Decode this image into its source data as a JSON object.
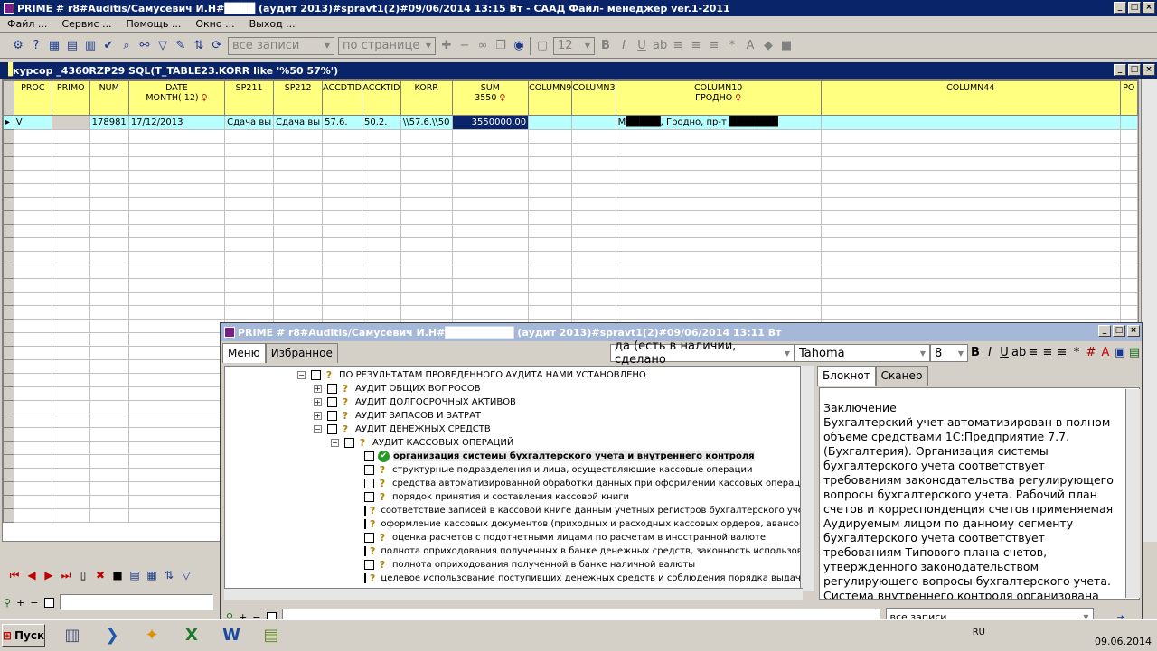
{
  "window": {
    "title": "PRIME # r8#Auditis/Самусевич И.Н#████ (аудит 2013)#spravt1(2)#09/06/2014 13:15 Вт - СААД Файл- менеджер ver.1-2011",
    "btn_min": "_",
    "btn_max": "□",
    "btn_close": "×"
  },
  "menu": {
    "items": [
      "Файл ...",
      "Сервис ...",
      "Помощь ...",
      "Окно ...",
      "Выход ..."
    ]
  },
  "toolbar": {
    "records_combo": "все записи",
    "page_combo": "по странице",
    "font_size": "12",
    "bold": "B",
    "italic": "I",
    "underline": "U"
  },
  "cursor_window": {
    "title": "курсор _4360RZP29 SQL(T_TABLE23.KORR like '%50 57%')"
  },
  "grid": {
    "columns": [
      {
        "l1": "PROC",
        "l2": ""
      },
      {
        "l1": "PRIMO",
        "l2": ""
      },
      {
        "l1": "NUM",
        "l2": ""
      },
      {
        "l1": "DATE",
        "l2": "MONTH( 12)"
      },
      {
        "l1": "SP211",
        "l2": ""
      },
      {
        "l1": "SP212",
        "l2": ""
      },
      {
        "l1": "ACCDTID",
        "l2": ""
      },
      {
        "l1": "ACCKTID",
        "l2": ""
      },
      {
        "l1": "KORR",
        "l2": ""
      },
      {
        "l1": "SUM",
        "l2": "3550"
      },
      {
        "l1": "COLUMN9",
        "l2": ""
      },
      {
        "l1": "COLUMN3",
        "l2": ""
      },
      {
        "l1": "COLUMN10",
        "l2": "ГРОДНО"
      },
      {
        "l1": "COLUMN44",
        "l2": ""
      },
      {
        "l1": "PO",
        "l2": ""
      }
    ],
    "row": [
      "V",
      "",
      "178981",
      "17/12/2013",
      "Сдача вы",
      "Сдача вы",
      "57.6.",
      "50.2.",
      "\\\\57.6.\\\\50",
      "3550000,00",
      "",
      "",
      "М█████, Гродно, пр-т ███████ ",
      "",
      ""
    ]
  },
  "footer_inputs": {
    "plus": "+",
    "minus": "−"
  },
  "dialog": {
    "title": "PRIME # r8#Auditis/Самусевич И.Н#█████████ (аудит 2013)#spravt1(2)#09/06/2014 13:11 Вт",
    "tab_menu": "Меню",
    "tab_fav": "Избранное",
    "answer_combo": "да (есть в наличии, сделано",
    "font_combo": "Tahoma",
    "font_size": "8",
    "tab_notebook": "Блокнот",
    "tab_scanner": "Сканер",
    "records_combo": "все записи",
    "tree": [
      {
        "level": 0,
        "expander": "−",
        "text": "ПО РЕЗУЛЬТАТАМ ПРОВЕДЕННОГО АУДИТА НАМИ УСТАНОВЛЕНО",
        "bold": false,
        "checked": false
      },
      {
        "level": 1,
        "expander": "+",
        "text": "АУДИТ ОБЩИХ ВОПРОСОВ",
        "bold": false,
        "checked": false
      },
      {
        "level": 1,
        "expander": "+",
        "text": "АУДИТ ДОЛГОСРОЧНЫХ АКТИВОВ",
        "bold": false,
        "checked": false
      },
      {
        "level": 1,
        "expander": "+",
        "text": "АУДИТ ЗАПАСОВ И ЗАТРАТ",
        "bold": false,
        "checked": false
      },
      {
        "level": 1,
        "expander": "−",
        "text": "АУДИТ ДЕНЕЖНЫХ СРЕДСТВ",
        "bold": false,
        "checked": false
      },
      {
        "level": 2,
        "expander": "−",
        "text": "АУДИТ КАССОВЫХ ОПЕРАЦИЙ",
        "bold": false,
        "checked": false
      },
      {
        "level": 3,
        "expander": "",
        "text": "организация системы бухгалтерского учета и внутреннего контроля",
        "bold": true,
        "checked": true
      },
      {
        "level": 3,
        "expander": "",
        "text": "структурные подразделения и лица, осуществляющие кассовые операции",
        "bold": false,
        "checked": false
      },
      {
        "level": 3,
        "expander": "",
        "text": "средства автоматизированной обработки данных при оформлении кассовых операций",
        "bold": false,
        "checked": false
      },
      {
        "level": 3,
        "expander": "",
        "text": "порядок принятия и составления кассовой книги",
        "bold": false,
        "checked": false
      },
      {
        "level": 3,
        "expander": "",
        "text": "соответствие записей в кассовой книге данным учетных регистров бухгалтерского учета",
        "bold": false,
        "checked": false
      },
      {
        "level": 3,
        "expander": "",
        "text": "оформление кассовых документов (приходных и расходных кассовых ордеров, авансовых от",
        "bold": false,
        "checked": false
      },
      {
        "level": 3,
        "expander": "",
        "text": "оценка расчетов с подотчетными лицами по расчетам в иностранной валюте",
        "bold": false,
        "checked": false
      },
      {
        "level": 3,
        "expander": "",
        "text": "полнота оприходования полученных в банке денежных средств, законность использования н",
        "bold": false,
        "checked": false
      },
      {
        "level": 3,
        "expander": "",
        "text": "полнота оприходования полученной в банке наличной валюты",
        "bold": false,
        "checked": false
      },
      {
        "level": 3,
        "expander": "",
        "text": "целевое использование поступивших денежных средств и соблюдения порядка выдачи дене",
        "bold": false,
        "checked": false
      }
    ],
    "notebook_text": "Заключение\nБухгалтерский учет автоматизирован в полном объеме средствами 1С:Предприятие 7.7. (Бухгалтерия). Организация системы бухгалтерского учета соответствует требованиям законодательства регулирующего вопросы бухгалтерского учета. Рабочий план счетов и корреспонденция счетов применяемая Аудируемым лицом по данному сегменту бухгалтерского учета соответствует требованиям Типового плана счетов, утвержденного законодательством регулирующего вопросы бухгалтерского учета. Система внутреннего контроля организована главным бухгалтером"
  },
  "taskbar": {
    "start": "Пуск",
    "tray_label": "RU",
    "date": "09.06.2014"
  }
}
